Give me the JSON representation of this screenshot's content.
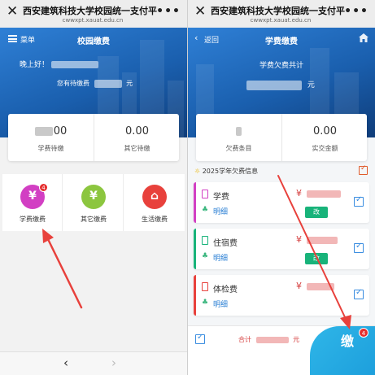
{
  "colors": {
    "primary_blue": "#1a5fae",
    "accent_red": "#e52d2d",
    "change_green": "#18b37a",
    "checkbox_blue": "#3a8de0",
    "pay_button_blue": "#1d9fdc"
  },
  "left": {
    "wx": {
      "close": "✕",
      "title": "西安建筑科技大学校园统一支付平",
      "domain": "cwwxpt.xauat.edu.cn",
      "more": "•••"
    },
    "nav": {
      "menu_label": "菜单",
      "title": "校园缴费"
    },
    "hero": {
      "greeting": "晚上好！",
      "pending_prefix": "您有待缴费",
      "pending_unit": "元"
    },
    "summary": [
      {
        "value": "00",
        "label": "学费待缴"
      },
      {
        "value": "0.00",
        "label": "其它待缴"
      }
    ],
    "apps": [
      {
        "name": "学费缴费",
        "icon": "yuan-icon",
        "glyph": "¥",
        "badge": "4",
        "color": "#d23fc3"
      },
      {
        "name": "其它缴费",
        "icon": "yuan-icon",
        "glyph": "¥",
        "badge": "",
        "color": "#8cc63f"
      },
      {
        "name": "生活缴费",
        "icon": "store-icon",
        "glyph": "⌂",
        "badge": "",
        "color": "#e8413c"
      }
    ],
    "bottom_nav": {
      "prev": "‹",
      "next": "›"
    }
  },
  "right": {
    "wx": {
      "close": "✕",
      "title": "西安建筑科技大学校园统一支付平",
      "domain": "cwwxpt.xauat.edu.cn",
      "more": "•••"
    },
    "nav": {
      "back_glyph": "‹",
      "back_label": "返回",
      "title": "学费缴费"
    },
    "hero": {
      "owe_label": "学费欠费共计",
      "owe_unit": "元"
    },
    "summary": [
      {
        "value": "",
        "label": "欠费条目"
      },
      {
        "value": "0.00",
        "label": "实交金额"
      }
    ],
    "section_title": "2025学年欠费信息",
    "items": [
      {
        "name": "学费",
        "detail": "明细",
        "currency": "¥",
        "change_label": "改",
        "bar_color": "#d23fc3"
      },
      {
        "name": "住宿费",
        "detail": "明细",
        "currency": "¥",
        "change_label": "改",
        "bar_color": "#18b37a"
      },
      {
        "name": "体检费",
        "detail": "明细",
        "currency": "¥",
        "change_label": "",
        "bar_color": "#e8413c"
      }
    ],
    "footer": {
      "total_prefix": "合计",
      "total_unit": "元",
      "pay_label": "缴",
      "pay_badge": "4"
    }
  }
}
